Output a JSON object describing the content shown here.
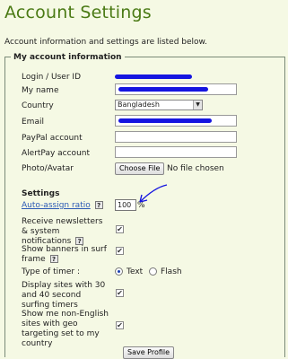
{
  "page": {
    "title": "Account Settings",
    "intro": "Account information and settings are listed below."
  },
  "account": {
    "legend": "My account information",
    "login_label": "Login / User ID",
    "name_label": "My name",
    "country_label": "Country",
    "country_value": "Bangladesh",
    "email_label": "Email",
    "paypal_label": "PayPal account",
    "alertpay_label": "AlertPay account",
    "photo_label": "Photo/Avatar",
    "choose_file": "Choose File",
    "no_file": "No file chosen"
  },
  "settings": {
    "heading": "Settings",
    "auto_assign_label": "Auto-assign ratio",
    "auto_assign_value": "100",
    "percent": "%",
    "newsletter_label": "Receive newsletters & system notifications",
    "banners_label": "Show banners in surf frame",
    "timer_label": "Type of timer :",
    "timer_text": "Text",
    "timer_flash": "Flash",
    "timer_selected": "Text",
    "display_timers_label": "Display sites with 30 and 40 second surfing timers",
    "non_english_label": "Show me non-English sites with geo targeting set to my country",
    "help_glyph": "?",
    "check_glyph": "✔",
    "save_label": "Save Profile"
  },
  "colors": {
    "title": "#4a7a14",
    "background": "#f5f9e4",
    "redaction": "#1515e0",
    "link": "#2b5ab5"
  }
}
